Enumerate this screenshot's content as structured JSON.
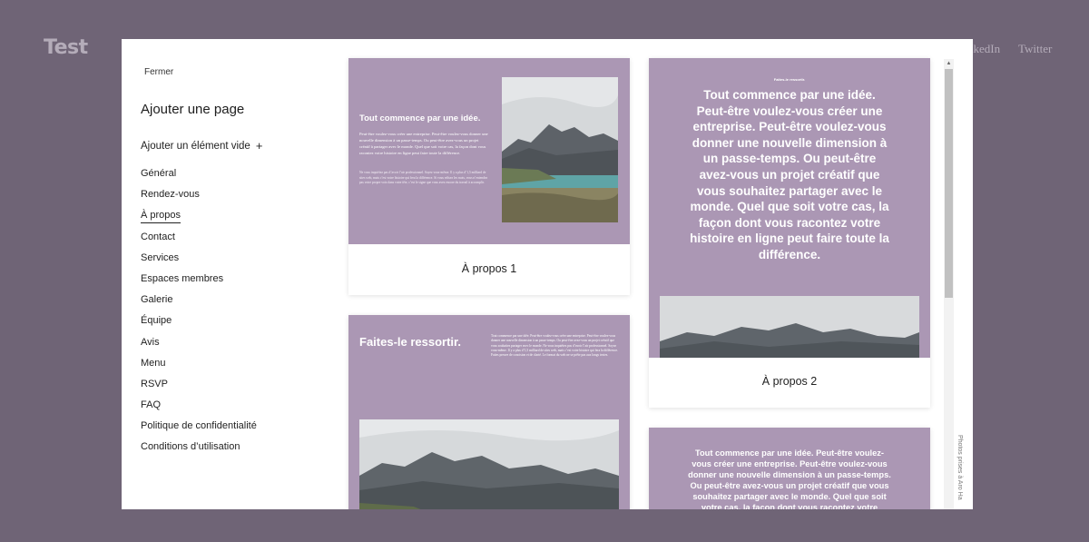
{
  "site": {
    "logo": "Test",
    "nav_linkedin": "nkedIn",
    "nav_twitter": "Twitter"
  },
  "modal": {
    "close_label": "Fermer",
    "title": "Ajouter une page",
    "add_blank_label": "Ajouter un élément vide",
    "categories": [
      "Général",
      "Rendez-vous",
      "À propos",
      "Contact",
      "Services",
      "Espaces membres",
      "Galerie",
      "Équipe",
      "Avis",
      "Menu",
      "RSVP",
      "FAQ",
      "Politique de confidentialité",
      "Conditions d’utilisation"
    ],
    "active_category": "À propos",
    "credit": "Photos prises à Aro Ha"
  },
  "templates": [
    {
      "label": "À propos 1",
      "preview_title": "Tout commence par une idée.",
      "preview_body": "Peut-être voulez-vous créer une entreprise. Peut-être voulez-vous donner une nouvelle dimension à un passe-temps. Ou peut-être avez-vous un projet créatif à partager avec le monde. Quel que soit votre cas, la façon dont vous racontez votre histoire en ligne peut faire toute la différence.",
      "preview_body2": "Ne vous inquiétez pas d’avoir l’air professionnel. Soyez vous-même. Il y a plus d’1,5 milliard de sites web, mais c’est votre histoire qui fera la différence. Si vous relisez les mots, vous n’entendez pas votre propre voix dans votre tête, c’est le signe que vous avez encore du travail à accomplir."
    },
    {
      "label": "À propos 2",
      "preview_small": "Faites-le ressortir.",
      "preview_big": "Tout commence par une idée. Peut-être voulez-vous créer une entreprise. Peut-être voulez-vous donner une nouvelle dimension à un passe-temps. Ou peut-être avez-vous un projet créatif que vous souhaitez partager avec le monde. Quel que soit votre cas, la façon dont vous racontez votre histoire en ligne peut faire toute la différence."
    },
    {
      "preview_title": "Faites-le ressortir.",
      "preview_body": "Tout commence par une idée. Peut-être voulez-vous créer une entreprise. Peut-être voulez-vous donner une nouvelle dimension à un passe-temps. Ou peut-être avez-vous un projet créatif que vous souhaitez partager avec le monde. Ne vous inquiétez pas d’avoir l’air professionnel. Soyez vous-même. Il y a plus d’1,5 milliard de sites web, mais c’est votre histoire qui fera la différence. Faites preuve de concision et de clarté. Le format du web ne se prête pas aux longs textes."
    },
    {
      "preview_mid": "Tout commence par une idée. Peut-être voulez-vous créer une entreprise. Peut-être voulez-vous donner une nouvelle dimension à un passe-temps. Ou peut-être avez-vous un projet créatif que vous souhaitez partager avec le monde. Quel que soit votre cas, la façon dont vous racontez votre histoire en ligne peut faire toute la différence."
    }
  ],
  "colors": {
    "overlay": "#6f6476",
    "thumbnail_bg": "#ab97b4",
    "modal_bg": "#ffffff"
  }
}
